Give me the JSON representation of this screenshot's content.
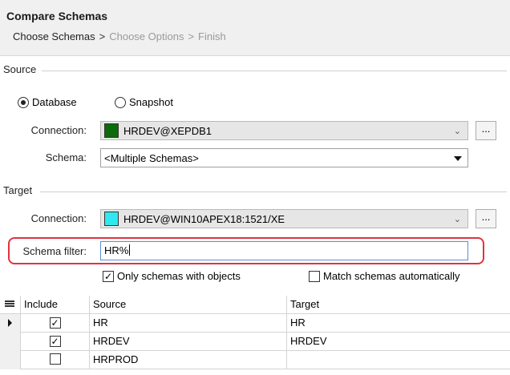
{
  "header": {
    "title": "Compare Schemas",
    "steps": [
      "Choose Schemas",
      "Choose Options",
      "Finish"
    ],
    "separator": ">"
  },
  "source": {
    "section_label": "Source",
    "radio_database": "Database",
    "radio_snapshot": "Snapshot",
    "selected": "Database",
    "connection_label": "Connection:",
    "connection_value": "HRDEV@XEPDB1",
    "connection_color": "#0b6b0b",
    "schema_label": "Schema:",
    "schema_value": "<Multiple Schemas>",
    "ellipsis": "..."
  },
  "target": {
    "section_label": "Target",
    "connection_label": "Connection:",
    "connection_value": "HRDEV@WIN10APEX18:1521/XE",
    "connection_color": "#31e8f0",
    "ellipsis": "...",
    "schema_filter_label": "Schema filter:",
    "schema_filter_value": "HR%",
    "only_with_objects_label": "Only schemas with objects",
    "only_with_objects_checked": true,
    "match_auto_label": "Match schemas automatically",
    "match_auto_checked": false
  },
  "grid": {
    "columns": [
      "Include",
      "Source",
      "Target"
    ],
    "rows": [
      {
        "include": true,
        "source": "HR",
        "target": "HR",
        "current": true
      },
      {
        "include": true,
        "source": "HRDEV",
        "target": "HRDEV",
        "current": false
      },
      {
        "include": false,
        "source": "HRPROD",
        "target": "",
        "current": false
      }
    ]
  }
}
